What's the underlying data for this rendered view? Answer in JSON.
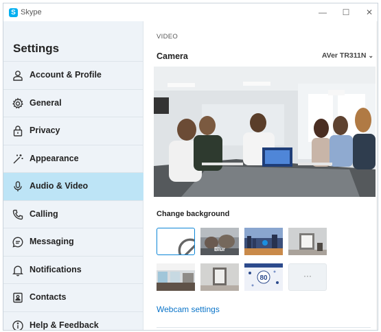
{
  "window": {
    "app_name": "Skype",
    "logo_letter": "S",
    "minimize": "—",
    "maximize": "☐",
    "close": "✕"
  },
  "sidebar": {
    "title": "Settings",
    "items": [
      {
        "label": "Account & Profile",
        "icon": "person-icon",
        "active": false
      },
      {
        "label": "General",
        "icon": "gear-icon",
        "active": false
      },
      {
        "label": "Privacy",
        "icon": "lock-icon",
        "active": false
      },
      {
        "label": "Appearance",
        "icon": "magic-wand-icon",
        "active": false
      },
      {
        "label": "Audio & Video",
        "icon": "microphone-icon",
        "active": true
      },
      {
        "label": "Calling",
        "icon": "phone-icon",
        "active": false
      },
      {
        "label": "Messaging",
        "icon": "chat-bubble-icon",
        "active": false
      },
      {
        "label": "Notifications",
        "icon": "bell-icon",
        "active": false
      },
      {
        "label": "Contacts",
        "icon": "contact-card-icon",
        "active": false
      },
      {
        "label": "Help & Feedback",
        "icon": "info-icon",
        "active": false
      }
    ]
  },
  "main": {
    "section": "VIDEO",
    "camera_label": "Camera",
    "camera_device": "AVer TR311N",
    "change_background": "Change background",
    "backgrounds": [
      {
        "name": "none",
        "label": ""
      },
      {
        "name": "blur",
        "label": "Blur"
      },
      {
        "name": "city-night",
        "label": ""
      },
      {
        "name": "room",
        "label": ""
      },
      {
        "name": "office",
        "label": ""
      },
      {
        "name": "hallway",
        "label": ""
      },
      {
        "name": "birthday-80",
        "label": ""
      },
      {
        "name": "more",
        "label": "···"
      }
    ],
    "webcam_settings": "Webcam settings"
  },
  "colors": {
    "accent": "#0a84d6",
    "sidebar_bg": "#eef3f8",
    "active_item_bg": "#bde4f6",
    "link": "#0a74c9"
  }
}
